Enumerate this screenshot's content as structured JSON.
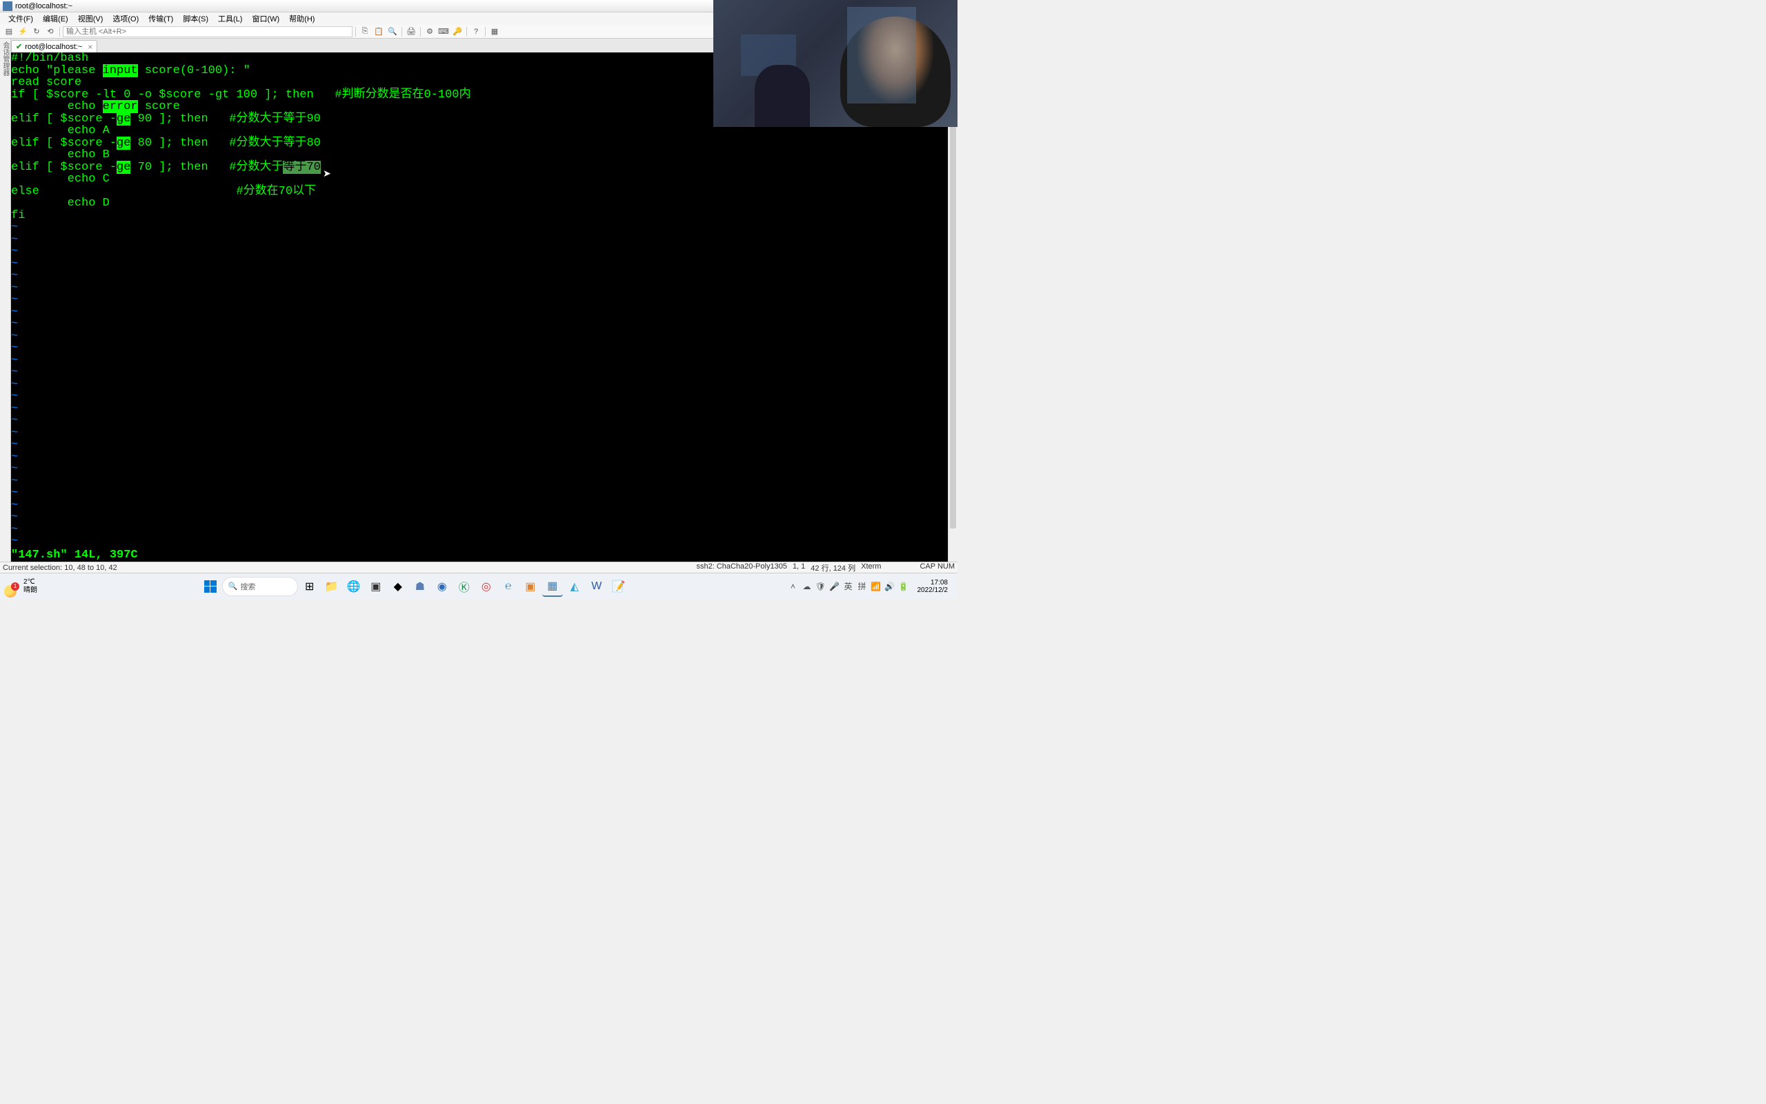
{
  "titlebar": {
    "title": "root@localhost:~"
  },
  "menus": {
    "file": "文件(F)",
    "edit": "编辑(E)",
    "view": "视图(V)",
    "options": "选项(O)",
    "transfer": "传输(T)",
    "script": "脚本(S)",
    "tools": "工具(L)",
    "window": "窗口(W)",
    "help": "帮助(H)"
  },
  "toolbar": {
    "host_placeholder": "输入主机 <Alt+R>"
  },
  "sidebar": {
    "label": "会话管理器"
  },
  "tab": {
    "title": "root@localhost:~",
    "close": "×"
  },
  "code": {
    "l1": "#!/bin/bash",
    "l2a": "echo \"please ",
    "l2hl": "input",
    "l2b": " score(0-100): \"",
    "l3": "read score",
    "l4a": "if [ $score -lt 0 -o $score -gt 100 ]; then   ",
    "l4c": "#判断分数是否在0-100内",
    "l5a": "        echo ",
    "l5hl": "error",
    "l5b": " score",
    "l6a": "elif [ $score -",
    "l6hl": "ge",
    "l6b": " 90 ]; then   ",
    "l6c": "#分数大于等于90",
    "l7": "        echo A",
    "l8a": "elif [ $score -",
    "l8hl": "ge",
    "l8b": " 80 ]; then   ",
    "l8c": "#分数大于等于80",
    "l9": "        echo B",
    "l10a": "elif [ $score -",
    "l10hl": "ge",
    "l10b": " 70 ]; then   ",
    "l10c": "#分数大于",
    "l10sel": "等于70",
    "l11": "        echo C",
    "l12a": "else",
    "l12pad": "                            ",
    "l12c": "#分数在70以下",
    "l13": "        echo D",
    "l14": "fi",
    "tilde": "~"
  },
  "vim_status": "\"147.sh\" 14L, 397C",
  "statusbar": {
    "selection": "Current selection: 10, 48 to 10, 42",
    "proto": "ssh2: ChaCha20-Poly1305",
    "pos": "1,   1",
    "size": "42 行, 124 列",
    "term": "Xterm",
    "cap": "CAP NUM"
  },
  "taskbar": {
    "weather_badge": "1",
    "weather_temp": "2℃",
    "weather_desc": "晴朗",
    "search": "搜索",
    "ime1": "英",
    "ime2": "拼",
    "time": "17:08",
    "date": "2022/12/2"
  }
}
